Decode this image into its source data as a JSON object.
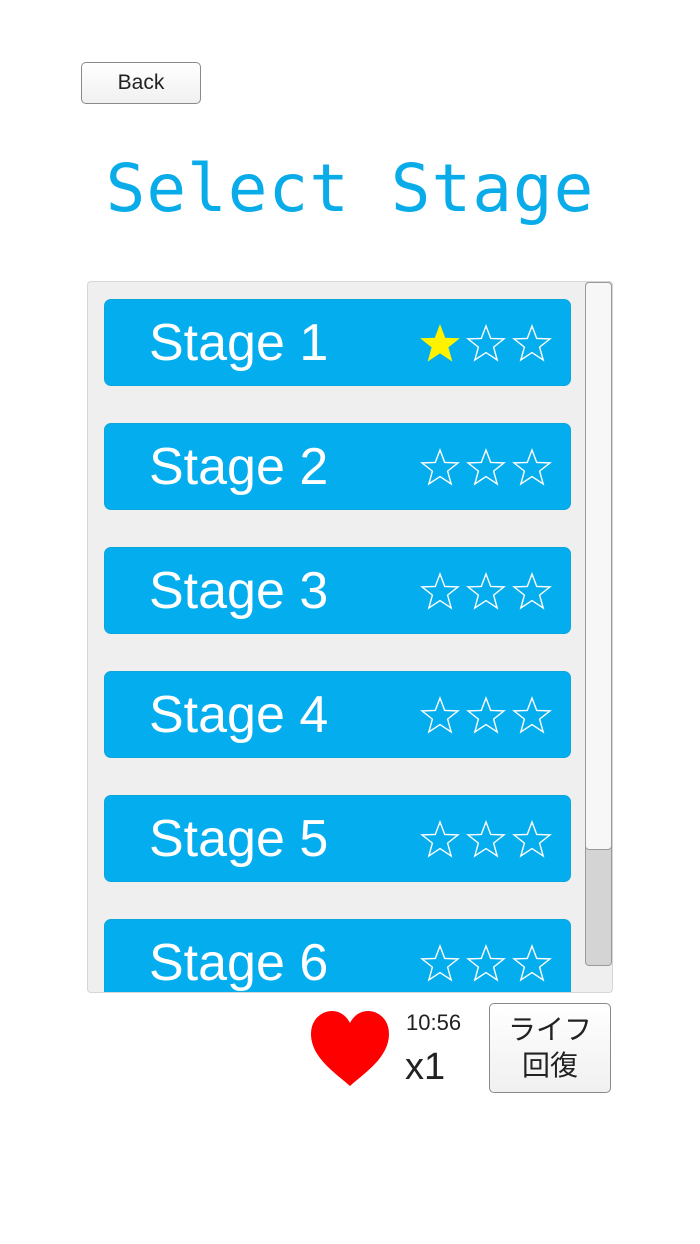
{
  "back_label": "Back",
  "title": "Select Stage",
  "stages": [
    {
      "label": "Stage 1",
      "stars_earned": 1,
      "stars_total": 3
    },
    {
      "label": "Stage 2",
      "stars_earned": 0,
      "stars_total": 3
    },
    {
      "label": "Stage 3",
      "stars_earned": 0,
      "stars_total": 3
    },
    {
      "label": "Stage 4",
      "stars_earned": 0,
      "stars_total": 3
    },
    {
      "label": "Stage 5",
      "stars_earned": 0,
      "stars_total": 3
    },
    {
      "label": "Stage 6",
      "stars_earned": 0,
      "stars_total": 3
    }
  ],
  "status": {
    "timer": "10:56",
    "lives": "x1",
    "recover_label_line1": "ライフ",
    "recover_label_line2": "回復"
  },
  "colors": {
    "accent": "#09ace9",
    "stage_button": "#04adee",
    "star_filled": "#fff200",
    "heart": "#ff0000"
  },
  "icons": {
    "heart": "heart-icon",
    "star_filled": "star-filled-icon",
    "star_empty": "star-outline-icon"
  }
}
